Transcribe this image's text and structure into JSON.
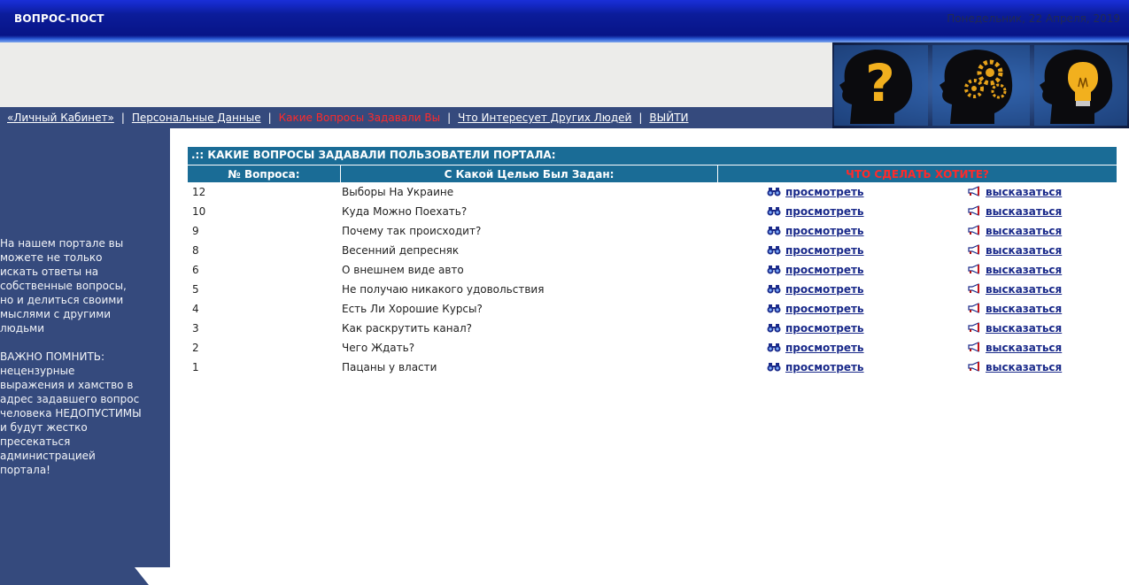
{
  "header": {
    "site_title": "ВОПРОС-ПОСТ",
    "date": "Понедельник, 22 Апреля, 2019"
  },
  "nav": {
    "items": [
      {
        "label": "«Личный Кабинет»",
        "active": false
      },
      {
        "label": "Персональные Данные",
        "active": false
      },
      {
        "label": "Какие Вопросы Задавали Вы",
        "active": true
      },
      {
        "label": "Что Интересует Других Людей",
        "active": false
      },
      {
        "label": "ВЫЙТИ",
        "active": false
      }
    ],
    "separator": "|"
  },
  "sidebar": {
    "intro": "На нашем портале вы можете не только искать ответы на собственные вопросы, но и делиться своими мыслями с другими людьми",
    "warning": "ВАЖНО ПОМНИТЬ: нецензурные выражения и хамство в адрес задавшего вопрос человека НЕДОПУСТИМЫ и будут жестко пресекаться администрацией портала!"
  },
  "table": {
    "title": ".:: КАКИЕ ВОПРОСЫ ЗАДАВАЛИ ПОЛЬЗОВАТЕЛИ ПОРТАЛА:",
    "col_number": "№ Вопроса:",
    "col_purpose": "С Какой Целью Был Задан:",
    "col_action": "ЧТО СДЕЛАТЬ ХОТИТЕ?",
    "view_label": "просмотреть",
    "reply_label": "высказаться",
    "rows": [
      {
        "num": "12",
        "title": "Выборы На Украине"
      },
      {
        "num": "10",
        "title": "Куда Можно Поехать?"
      },
      {
        "num": "9",
        "title": "Почему так происходит?"
      },
      {
        "num": "8",
        "title": "Весенний депресняк"
      },
      {
        "num": "6",
        "title": "О внешнем виде авто"
      },
      {
        "num": "5",
        "title": "Не получаю никакого удовольствия"
      },
      {
        "num": "4",
        "title": "Есть Ли Хорошие Курсы?"
      },
      {
        "num": "3",
        "title": "Как раскрутить канал?"
      },
      {
        "num": "2",
        "title": "Чего Ждать?"
      },
      {
        "num": "1",
        "title": "Пацаны у власти"
      }
    ]
  },
  "colors": {
    "header_blue": "#071487",
    "nav_blue": "#354a7d",
    "table_head": "#1a6c96",
    "active_red": "#ff2a2a",
    "link_blue": "#1a2a8a"
  },
  "icons": {
    "view": "binoculars-icon",
    "reply": "megaphone-icon",
    "banner": [
      "question-head-icon",
      "gears-head-icon",
      "lightbulb-head-icon"
    ]
  }
}
